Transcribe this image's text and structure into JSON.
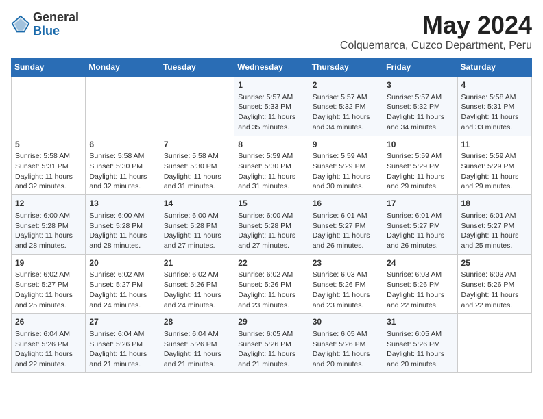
{
  "header": {
    "logo_general": "General",
    "logo_blue": "Blue",
    "title": "May 2024",
    "subtitle": "Colquemarca, Cuzco Department, Peru"
  },
  "calendar": {
    "days_of_week": [
      "Sunday",
      "Monday",
      "Tuesday",
      "Wednesday",
      "Thursday",
      "Friday",
      "Saturday"
    ],
    "weeks": [
      [
        {
          "day": "",
          "info": ""
        },
        {
          "day": "",
          "info": ""
        },
        {
          "day": "",
          "info": ""
        },
        {
          "day": "1",
          "info": "Sunrise: 5:57 AM\nSunset: 5:33 PM\nDaylight: 11 hours and 35 minutes."
        },
        {
          "day": "2",
          "info": "Sunrise: 5:57 AM\nSunset: 5:32 PM\nDaylight: 11 hours and 34 minutes."
        },
        {
          "day": "3",
          "info": "Sunrise: 5:57 AM\nSunset: 5:32 PM\nDaylight: 11 hours and 34 minutes."
        },
        {
          "day": "4",
          "info": "Sunrise: 5:58 AM\nSunset: 5:31 PM\nDaylight: 11 hours and 33 minutes."
        }
      ],
      [
        {
          "day": "5",
          "info": "Sunrise: 5:58 AM\nSunset: 5:31 PM\nDaylight: 11 hours and 32 minutes."
        },
        {
          "day": "6",
          "info": "Sunrise: 5:58 AM\nSunset: 5:30 PM\nDaylight: 11 hours and 32 minutes."
        },
        {
          "day": "7",
          "info": "Sunrise: 5:58 AM\nSunset: 5:30 PM\nDaylight: 11 hours and 31 minutes."
        },
        {
          "day": "8",
          "info": "Sunrise: 5:59 AM\nSunset: 5:30 PM\nDaylight: 11 hours and 31 minutes."
        },
        {
          "day": "9",
          "info": "Sunrise: 5:59 AM\nSunset: 5:29 PM\nDaylight: 11 hours and 30 minutes."
        },
        {
          "day": "10",
          "info": "Sunrise: 5:59 AM\nSunset: 5:29 PM\nDaylight: 11 hours and 29 minutes."
        },
        {
          "day": "11",
          "info": "Sunrise: 5:59 AM\nSunset: 5:29 PM\nDaylight: 11 hours and 29 minutes."
        }
      ],
      [
        {
          "day": "12",
          "info": "Sunrise: 6:00 AM\nSunset: 5:28 PM\nDaylight: 11 hours and 28 minutes."
        },
        {
          "day": "13",
          "info": "Sunrise: 6:00 AM\nSunset: 5:28 PM\nDaylight: 11 hours and 28 minutes."
        },
        {
          "day": "14",
          "info": "Sunrise: 6:00 AM\nSunset: 5:28 PM\nDaylight: 11 hours and 27 minutes."
        },
        {
          "day": "15",
          "info": "Sunrise: 6:00 AM\nSunset: 5:28 PM\nDaylight: 11 hours and 27 minutes."
        },
        {
          "day": "16",
          "info": "Sunrise: 6:01 AM\nSunset: 5:27 PM\nDaylight: 11 hours and 26 minutes."
        },
        {
          "day": "17",
          "info": "Sunrise: 6:01 AM\nSunset: 5:27 PM\nDaylight: 11 hours and 26 minutes."
        },
        {
          "day": "18",
          "info": "Sunrise: 6:01 AM\nSunset: 5:27 PM\nDaylight: 11 hours and 25 minutes."
        }
      ],
      [
        {
          "day": "19",
          "info": "Sunrise: 6:02 AM\nSunset: 5:27 PM\nDaylight: 11 hours and 25 minutes."
        },
        {
          "day": "20",
          "info": "Sunrise: 6:02 AM\nSunset: 5:27 PM\nDaylight: 11 hours and 24 minutes."
        },
        {
          "day": "21",
          "info": "Sunrise: 6:02 AM\nSunset: 5:26 PM\nDaylight: 11 hours and 24 minutes."
        },
        {
          "day": "22",
          "info": "Sunrise: 6:02 AM\nSunset: 5:26 PM\nDaylight: 11 hours and 23 minutes."
        },
        {
          "day": "23",
          "info": "Sunrise: 6:03 AM\nSunset: 5:26 PM\nDaylight: 11 hours and 23 minutes."
        },
        {
          "day": "24",
          "info": "Sunrise: 6:03 AM\nSunset: 5:26 PM\nDaylight: 11 hours and 22 minutes."
        },
        {
          "day": "25",
          "info": "Sunrise: 6:03 AM\nSunset: 5:26 PM\nDaylight: 11 hours and 22 minutes."
        }
      ],
      [
        {
          "day": "26",
          "info": "Sunrise: 6:04 AM\nSunset: 5:26 PM\nDaylight: 11 hours and 22 minutes."
        },
        {
          "day": "27",
          "info": "Sunrise: 6:04 AM\nSunset: 5:26 PM\nDaylight: 11 hours and 21 minutes."
        },
        {
          "day": "28",
          "info": "Sunrise: 6:04 AM\nSunset: 5:26 PM\nDaylight: 11 hours and 21 minutes."
        },
        {
          "day": "29",
          "info": "Sunrise: 6:05 AM\nSunset: 5:26 PM\nDaylight: 11 hours and 21 minutes."
        },
        {
          "day": "30",
          "info": "Sunrise: 6:05 AM\nSunset: 5:26 PM\nDaylight: 11 hours and 20 minutes."
        },
        {
          "day": "31",
          "info": "Sunrise: 6:05 AM\nSunset: 5:26 PM\nDaylight: 11 hours and 20 minutes."
        },
        {
          "day": "",
          "info": ""
        }
      ]
    ]
  }
}
